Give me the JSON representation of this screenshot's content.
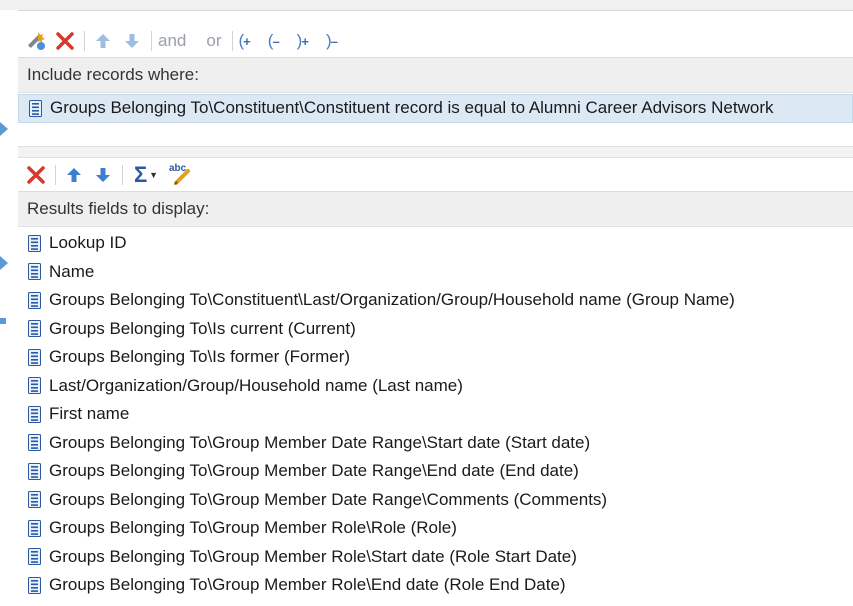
{
  "filter_toolbar": {
    "and_label": "and",
    "or_label": "or",
    "open_paren": "(",
    "close_paren": ")",
    "plus": "+",
    "minus": "–"
  },
  "filter_panel": {
    "header": "Include records where:",
    "criteria": [
      "Groups Belonging To\\Constituent\\Constituent record is equal to Alumni Career Advisors Network"
    ]
  },
  "results_toolbar": {
    "sigma_label": "Σ",
    "spell_label": "abc"
  },
  "results_panel": {
    "header": "Results fields to display:",
    "fields": [
      "Lookup ID",
      "Name",
      "Groups Belonging To\\Constituent\\Last/Organization/Group/Household name (Group Name)",
      "Groups Belonging To\\Is current (Current)",
      "Groups Belonging To\\Is former (Former)",
      "Last/Organization/Group/Household name (Last name)",
      "First name",
      "Groups Belonging To\\Group Member Date Range\\Start date (Start date)",
      "Groups Belonging To\\Group Member Date Range\\End date (End date)",
      "Groups Belonging To\\Group Member Date Range\\Comments (Comments)",
      "Groups Belonging To\\Group Member Role\\Role (Role)",
      "Groups Belonging To\\Group Member Role\\Start date (Role Start Date)",
      "Groups Belonging To\\Group Member Role\\End date (Role End Date)"
    ]
  },
  "icons": {
    "filter_toolbar": [
      "wand-icon",
      "delete-icon",
      "move-up-icon",
      "move-down-icon"
    ],
    "results_toolbar": [
      "delete-icon",
      "move-up-icon",
      "move-down-icon",
      "summarize-icon",
      "rename-icon"
    ],
    "field": "field-document-icon"
  },
  "colors": {
    "accent_blue": "#3c7fd0",
    "delete_red": "#d43a2e",
    "header_bg": "#efefef",
    "selected_bg": "#dde8f5"
  }
}
